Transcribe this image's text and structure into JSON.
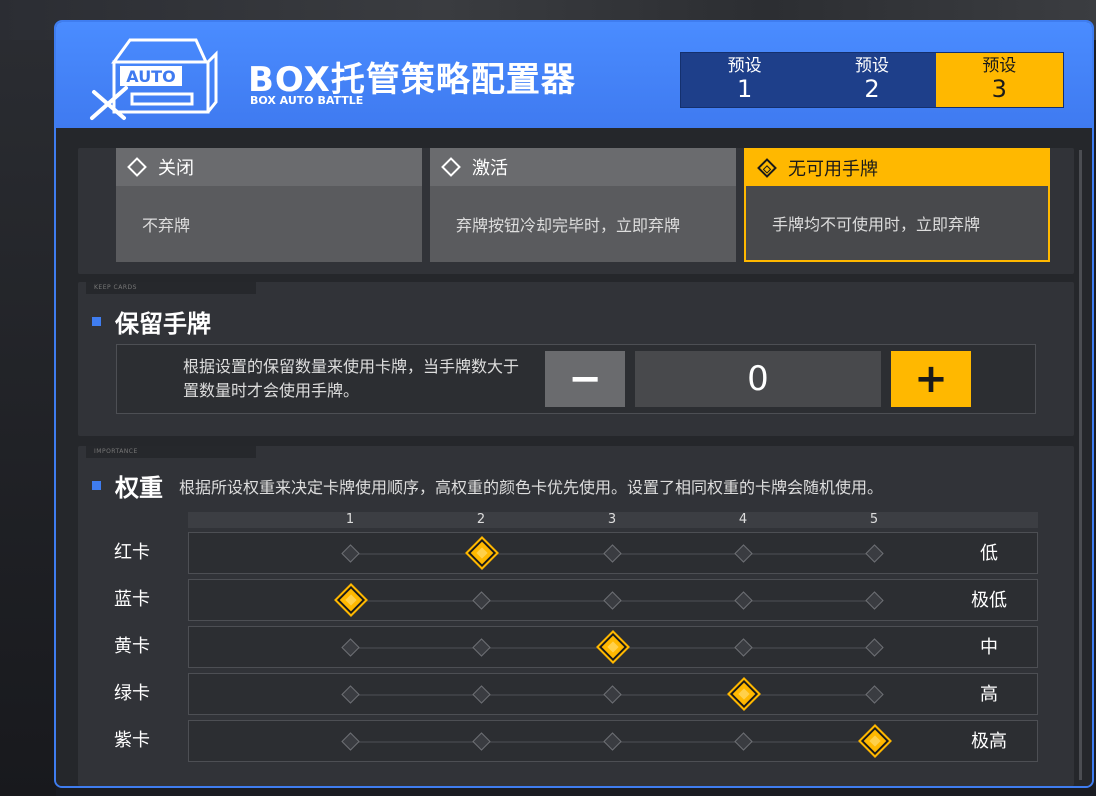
{
  "header": {
    "title": "BOX托管策略配置器",
    "subtitle": "BOX AUTO BATTLE",
    "logo_text": "AUTO",
    "presets": [
      {
        "label": "预设",
        "num": "1"
      },
      {
        "label": "预设",
        "num": "2"
      },
      {
        "label": "预设",
        "num": "3"
      }
    ],
    "active_preset": 3
  },
  "discard": {
    "options": [
      {
        "title": "关闭",
        "desc": "不弃牌"
      },
      {
        "title": "激活",
        "desc": "弃牌按钮冷却完毕时，立即弃牌"
      },
      {
        "title": "无可用手牌",
        "desc": "手牌均不可使用时，立即弃牌"
      }
    ],
    "selected": 3
  },
  "keep": {
    "tag": "KEEP CARDS",
    "title": "保留手牌",
    "desc": "根据设置的保留数量来使用卡牌，当手牌数大于置数量时才会使用手牌。",
    "minus": "−",
    "value": "0",
    "plus": "+"
  },
  "weight": {
    "tag": "IMPORTANCE",
    "title": "权重",
    "desc": "根据所设权重来决定卡牌使用顺序，高权重的颜色卡优先使用。设置了相同权重的卡牌会随机使用。",
    "scale": [
      "1",
      "2",
      "3",
      "4",
      "5"
    ],
    "rows": [
      {
        "label": "红卡",
        "level": 2,
        "value": "低"
      },
      {
        "label": "蓝卡",
        "level": 1,
        "value": "极低"
      },
      {
        "label": "黄卡",
        "level": 3,
        "value": "中"
      },
      {
        "label": "绿卡",
        "level": 4,
        "value": "高"
      },
      {
        "label": "紫卡",
        "level": 5,
        "value": "极高"
      }
    ]
  },
  "colors": {
    "accent": "#ffb800",
    "header_blue": "#4a8cff",
    "marker_blue": "#3f7df0"
  }
}
